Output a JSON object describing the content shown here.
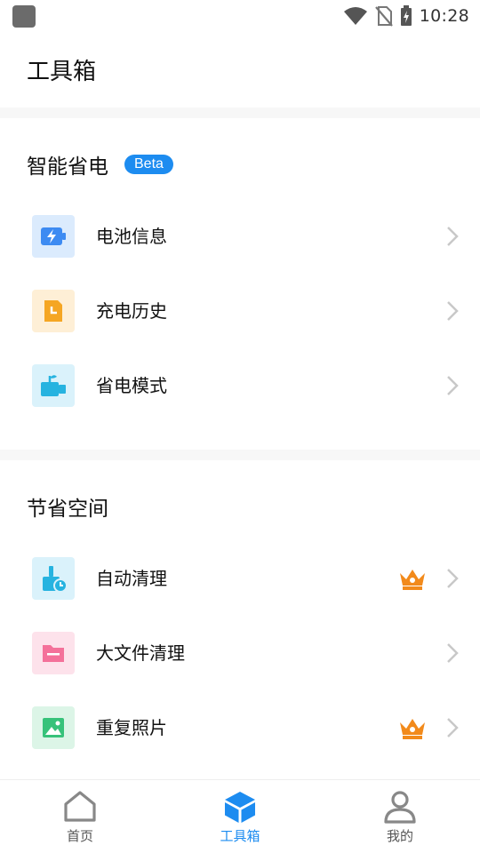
{
  "status_bar": {
    "time": "10:28"
  },
  "page": {
    "title": "工具箱"
  },
  "sections": [
    {
      "title": "智能省电",
      "badge": "Beta",
      "items": [
        {
          "label": "电池信息",
          "icon": "battery-icon",
          "color": "#3d8bf2",
          "bg": "#dbebfd",
          "premium": false
        },
        {
          "label": "充电历史",
          "icon": "history-doc-icon",
          "color": "#f5a623",
          "bg": "#feefd6",
          "premium": false
        },
        {
          "label": "省电模式",
          "icon": "power-saving-icon",
          "color": "#26b3e0",
          "bg": "#daf2fb",
          "premium": false
        }
      ]
    },
    {
      "title": "节省空间",
      "items": [
        {
          "label": "自动清理",
          "icon": "auto-clean-icon",
          "color": "#26b3e0",
          "bg": "#daf2fb",
          "premium": true
        },
        {
          "label": "大文件清理",
          "icon": "folder-icon",
          "color": "#f4719a",
          "bg": "#fde2eb",
          "premium": false
        },
        {
          "label": "重复照片",
          "icon": "photo-icon",
          "color": "#37c27a",
          "bg": "#dcf5e7",
          "premium": true
        }
      ]
    }
  ],
  "bottom_nav": {
    "items": [
      {
        "label": "首页",
        "icon": "home-icon",
        "active": false
      },
      {
        "label": "工具箱",
        "icon": "toolbox-cube-icon",
        "active": true
      },
      {
        "label": "我的",
        "icon": "profile-icon",
        "active": false
      }
    ]
  },
  "colors": {
    "accent": "#1d8cf0",
    "crown": "#f28a1b",
    "chevron": "#c8c8c8"
  }
}
